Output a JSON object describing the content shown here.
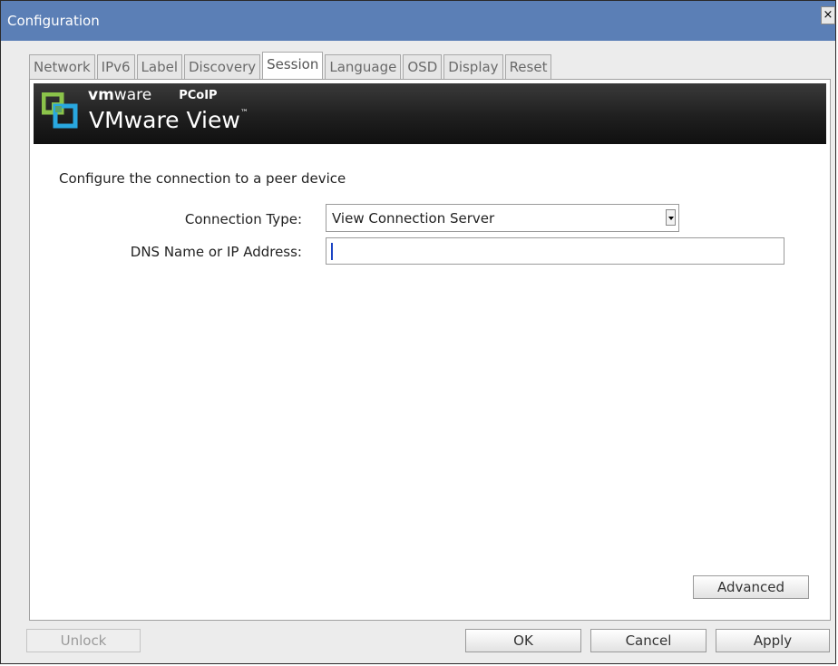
{
  "window": {
    "title": "Configuration",
    "close_glyph": "×"
  },
  "tabs": [
    {
      "label": "Network"
    },
    {
      "label": "IPv6"
    },
    {
      "label": "Label"
    },
    {
      "label": "Discovery"
    },
    {
      "label": "Session",
      "active": true
    },
    {
      "label": "Language"
    },
    {
      "label": "OSD"
    },
    {
      "label": "Display"
    },
    {
      "label": "Reset"
    }
  ],
  "banner": {
    "brand_bold": "vm",
    "brand_light": "ware",
    "partner": "PCoIP",
    "product": "VMware View",
    "product_mark": "™",
    "logo_icon": "vmware-view-logo"
  },
  "session": {
    "description": "Configure the connection to a peer device",
    "connection_type_label": "Connection Type:",
    "connection_type_value": "View Connection Server",
    "dns_label": "DNS Name or IP Address:",
    "dns_value": "",
    "advanced_label": "Advanced"
  },
  "footer": {
    "unlock_label": "Unlock",
    "ok_label": "OK",
    "cancel_label": "Cancel",
    "apply_label": "Apply"
  },
  "colors": {
    "titlebar": "#5b7fb6",
    "banner": "#1f1f1f",
    "logo_green": "#8bc34a",
    "logo_blue": "#29a8e0"
  }
}
